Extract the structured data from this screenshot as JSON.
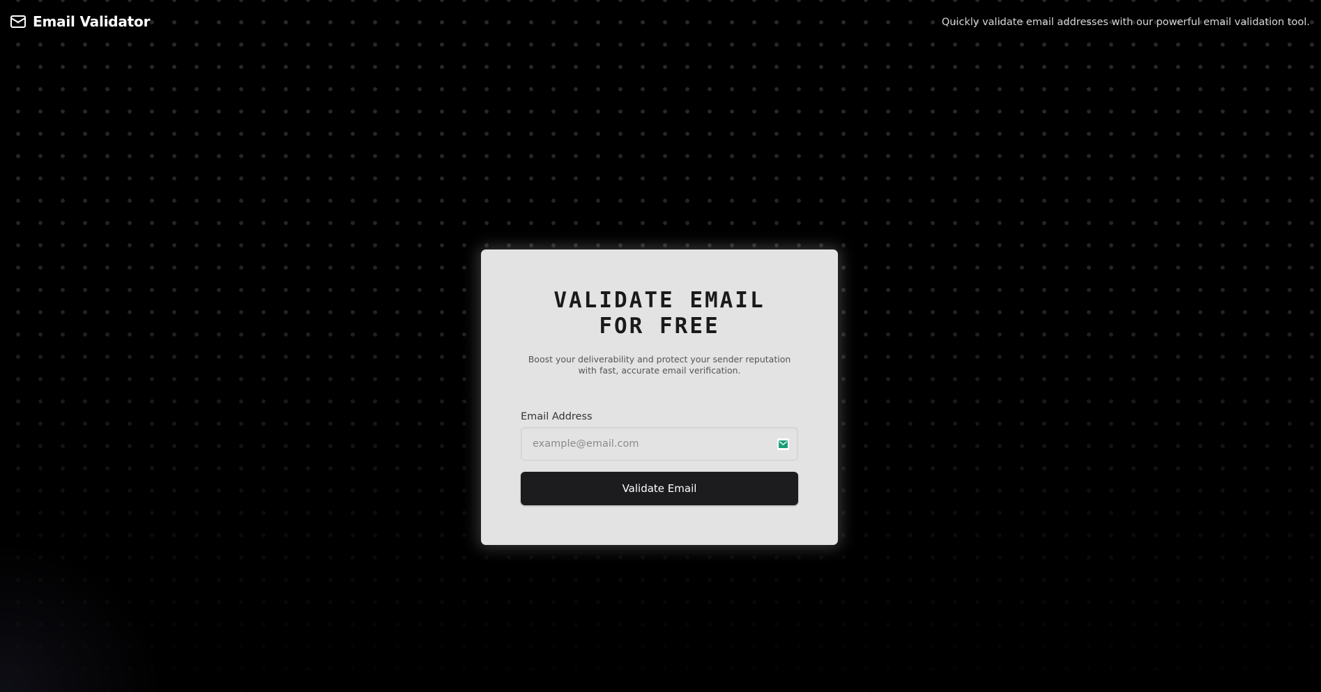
{
  "header": {
    "brand_icon": "mail-icon",
    "title": "Email Validator",
    "tagline": "Quickly validate email addresses with our powerful email validation tool."
  },
  "card": {
    "title_line1": "VALIDATE EMAIL",
    "title_line2": "FOR FREE",
    "description": "Boost your deliverability and protect your sender reputation with fast, accurate email verification.",
    "email_field": {
      "label": "Email Address",
      "value": "",
      "placeholder": "example@email.com",
      "icon": "envelope-icon"
    },
    "submit_label": "Validate Email"
  },
  "colors": {
    "background": "#000000",
    "card": "#e3e3e3",
    "button": "#1c1c1e",
    "icon_accent": "#1a9e7a"
  }
}
